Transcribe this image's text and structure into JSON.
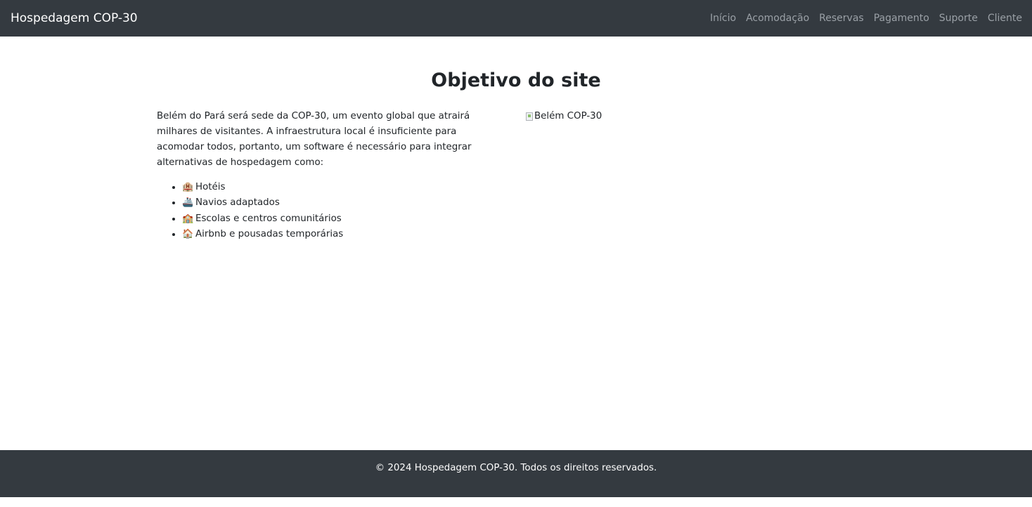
{
  "navbar": {
    "brand": "Hospedagem COP-30",
    "links": [
      "Início",
      "Acomodação",
      "Reservas",
      "Pagamento",
      "Suporte",
      "Cliente"
    ]
  },
  "main": {
    "title": "Objetivo do site",
    "intro": "Belém do Pará será sede da COP-30, um evento global que atrairá milhares de visitantes. A infraestrutura local é insuficiente para acomodar todos, portanto, um software é necessário para integrar alternativas de hospedagem como:",
    "features": [
      {
        "icon": "hotel-icon",
        "glyph": "🏨",
        "label": "Hotéis"
      },
      {
        "icon": "ship-icon",
        "glyph": "🚢",
        "label": "Navios adaptados"
      },
      {
        "icon": "school-icon",
        "glyph": "🏫",
        "label": "Escolas e centros comunitários"
      },
      {
        "icon": "house-icon",
        "glyph": "🏠",
        "label": "Airbnb e pousadas temporárias"
      }
    ],
    "image_alt": "Belém COP-30"
  },
  "footer": {
    "text": "© 2024 Hospedagem COP-30. Todos os direitos reservados."
  },
  "colors": {
    "navbar_bg": "#343a40",
    "footer_bg": "#343a40",
    "nav_link": "#9aa0a6",
    "brand": "#ffffff"
  }
}
